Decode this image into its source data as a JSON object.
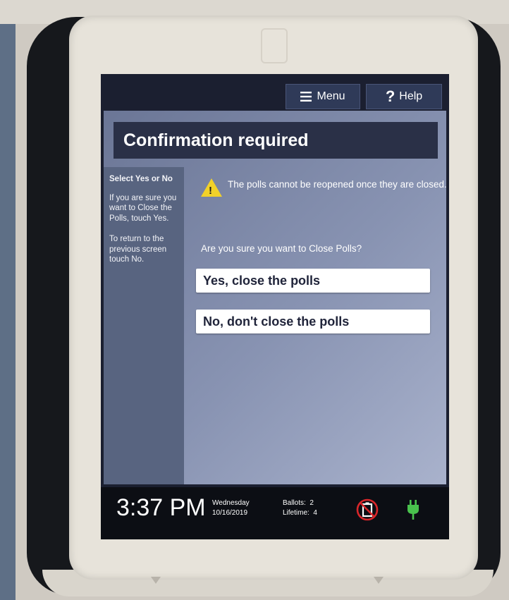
{
  "header": {
    "menu_label": "Menu",
    "help_label": "Help",
    "menu_icon": "hamburger-icon",
    "help_icon": "question-icon"
  },
  "dialog": {
    "title": "Confirmation required",
    "warning_icon": "warning-icon",
    "warning_text": "The polls cannot be reopened once they are closed.",
    "question": "Are you sure you want to Close Polls?",
    "yes_label": "Yes, close the polls",
    "no_label": "No, don't close the polls"
  },
  "sidebar": {
    "heading": "Select Yes or No",
    "instruction_1": "If you are sure you want to Close the Polls, touch Yes.",
    "instruction_2": "To return to the previous screen touch No."
  },
  "status_bar": {
    "time": "3:37 PM",
    "day": "Wednesday",
    "date": "10/16/2019",
    "ballots_label": "Ballots:",
    "ballots_value": "2",
    "lifetime_label": "Lifetime:",
    "lifetime_value": "4",
    "battery_icon": "no-battery-icon",
    "power_icon": "power-plug-icon"
  },
  "colors": {
    "title_bar": "#2a3047",
    "panel": "#586480",
    "warning": "#f2d129",
    "no_battery": "#d9262a",
    "plug": "#49c24d"
  }
}
